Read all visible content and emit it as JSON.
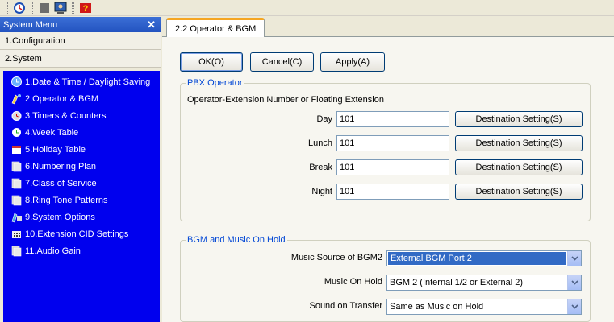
{
  "sidebar": {
    "title": "System Menu",
    "close_glyph": "✕",
    "sections": [
      {
        "label": "1.Configuration"
      },
      {
        "label": "2.System"
      }
    ],
    "items": [
      {
        "label": "1.Date & Time / Daylight Saving",
        "icon": "globe-clock-icon"
      },
      {
        "label": "2.Operator & BGM",
        "icon": "operator-icon"
      },
      {
        "label": "3.Timers & Counters",
        "icon": "timer-icon"
      },
      {
        "label": "4.Week Table",
        "icon": "week-table-icon"
      },
      {
        "label": "5.Holiday Table",
        "icon": "holiday-icon"
      },
      {
        "label": "6.Numbering Plan",
        "icon": "folder-icon"
      },
      {
        "label": "7.Class of Service",
        "icon": "folder-icon"
      },
      {
        "label": "8.Ring Tone Patterns",
        "icon": "folder-icon"
      },
      {
        "label": "9.System Options",
        "icon": "system-options-icon"
      },
      {
        "label": "10.Extension CID Settings",
        "icon": "phone-keypad-icon"
      },
      {
        "label": "11.Audio Gain",
        "icon": "folder-icon"
      }
    ]
  },
  "tab": {
    "label": "2.2 Operator & BGM"
  },
  "buttons": {
    "ok": "OK(O)",
    "cancel": "Cancel(C)",
    "apply": "Apply(A)"
  },
  "pbx": {
    "title": "PBX Operator",
    "subtitle": "Operator-Extension Number or Floating Extension",
    "destination_label": "Destination Setting(S)",
    "rows": [
      {
        "label": "Day",
        "value": "101"
      },
      {
        "label": "Lunch",
        "value": "101"
      },
      {
        "label": "Break",
        "value": "101"
      },
      {
        "label": "Night",
        "value": "101"
      }
    ]
  },
  "bgm": {
    "title": "BGM and Music On Hold",
    "rows": [
      {
        "label": "Music Source of BGM2",
        "value": "External BGM Port 2"
      },
      {
        "label": "Music On Hold",
        "value": "BGM 2 (Internal 1/2 or External 2)"
      },
      {
        "label": "Sound on Transfer",
        "value": "Same as Music on Hold"
      }
    ]
  },
  "colors": {
    "accent": "#316ac5",
    "sidebar_bg": "#0000ee",
    "tab_highlight": "#f5a623",
    "group_title": "#0046d5"
  }
}
